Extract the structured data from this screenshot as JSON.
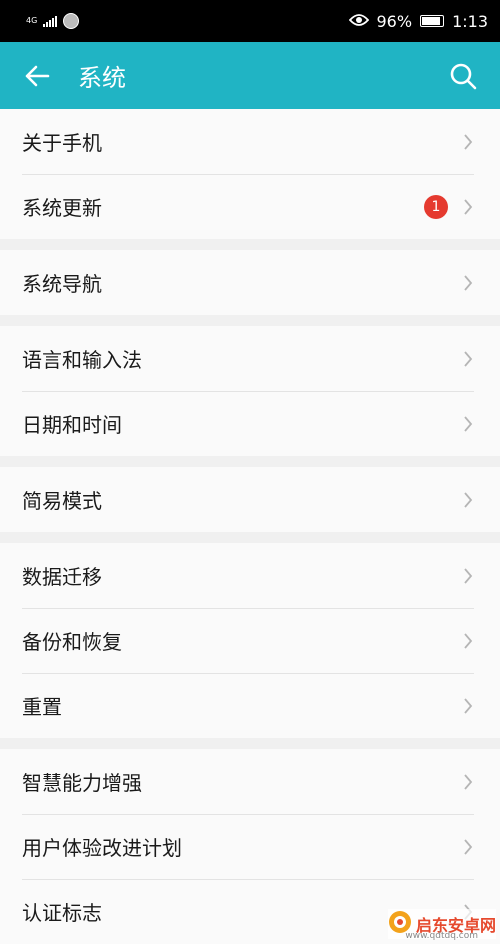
{
  "status_bar": {
    "network": "4G",
    "battery_percent": "96%",
    "time": "1:13",
    "icons": [
      "signal-icon",
      "app-notification-icon",
      "eye-icon",
      "battery-icon"
    ]
  },
  "app_bar": {
    "title": "系统",
    "color": "#20b4c4",
    "icons": [
      "back-arrow-icon",
      "search-icon"
    ]
  },
  "groups": [
    {
      "items": [
        {
          "label": "关于手机"
        },
        {
          "label": "系统更新",
          "badge": "1"
        }
      ]
    },
    {
      "items": [
        {
          "label": "系统导航"
        }
      ]
    },
    {
      "items": [
        {
          "label": "语言和输入法"
        },
        {
          "label": "日期和时间"
        }
      ]
    },
    {
      "items": [
        {
          "label": "简易模式"
        }
      ]
    },
    {
      "items": [
        {
          "label": "数据迁移"
        },
        {
          "label": "备份和恢复"
        },
        {
          "label": "重置"
        }
      ]
    },
    {
      "items": [
        {
          "label": "智慧能力增强"
        },
        {
          "label": "用户体验改进计划"
        },
        {
          "label": "认证标志"
        }
      ]
    }
  ],
  "badge_color": "#e53a2f",
  "watermark": {
    "text": "启东安卓网",
    "url": "www.qdtdq.com"
  }
}
